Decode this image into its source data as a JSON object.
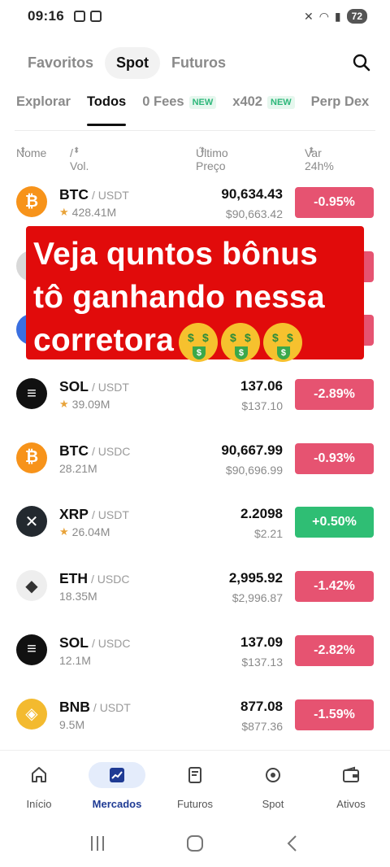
{
  "status_bar": {
    "time": "09:16",
    "battery": "72"
  },
  "market_tabs": [
    {
      "label": "Favoritos",
      "active": false
    },
    {
      "label": "Spot",
      "active": true
    },
    {
      "label": "Futuros",
      "active": false
    }
  ],
  "category_tabs": [
    {
      "label": "Explorar",
      "active": false,
      "badge": ""
    },
    {
      "label": "Todos",
      "active": true,
      "badge": ""
    },
    {
      "label": "0 Fees",
      "active": false,
      "badge": "NEW"
    },
    {
      "label": "x402",
      "active": false,
      "badge": "NEW"
    },
    {
      "label": "Perp Dex",
      "active": false,
      "badge": ""
    }
  ],
  "columns": {
    "name": "Nome",
    "vol": "/ Vol.",
    "price": "Último Preço",
    "change": "Var 24h%"
  },
  "rows": [
    {
      "base": "BTC",
      "quote": "USDT",
      "volume": "428.41M",
      "starred": true,
      "price": "90,634.43",
      "price_usd": "$90,663.42",
      "change": "-0.95%",
      "direction": "neg",
      "icon": "bitcoin-icon",
      "icon_color": "#f7931a"
    },
    {
      "base": "",
      "quote": "",
      "volume": "",
      "starred": false,
      "price": "",
      "price_usd": "",
      "change": "",
      "direction": "neg",
      "icon": "coin-icon",
      "icon_color": "#d8d8d8"
    },
    {
      "base": "",
      "quote": "",
      "volume": "",
      "starred": false,
      "price": "",
      "price_usd": "",
      "change": "",
      "direction": "neg",
      "icon": "coin-icon",
      "icon_color": "#3a6fe0"
    },
    {
      "base": "SOL",
      "quote": "USDT",
      "volume": "39.09M",
      "starred": true,
      "price": "137.06",
      "price_usd": "$137.10",
      "change": "-2.89%",
      "direction": "neg",
      "icon": "solana-icon",
      "icon_color": "#111111"
    },
    {
      "base": "BTC",
      "quote": "USDC",
      "volume": "28.21M",
      "starred": false,
      "price": "90,667.99",
      "price_usd": "$90,696.99",
      "change": "-0.93%",
      "direction": "neg",
      "icon": "bitcoin-icon",
      "icon_color": "#f7931a"
    },
    {
      "base": "XRP",
      "quote": "USDT",
      "volume": "26.04M",
      "starred": true,
      "price": "2.2098",
      "price_usd": "$2.21",
      "change": "+0.50%",
      "direction": "pos",
      "icon": "xrp-icon",
      "icon_color": "#23292f"
    },
    {
      "base": "ETH",
      "quote": "USDC",
      "volume": "18.35M",
      "starred": false,
      "price": "2,995.92",
      "price_usd": "$2,996.87",
      "change": "-1.42%",
      "direction": "neg",
      "icon": "ethereum-icon",
      "icon_color": "#eeeeee"
    },
    {
      "base": "SOL",
      "quote": "USDC",
      "volume": "12.1M",
      "starred": false,
      "price": "137.09",
      "price_usd": "$137.13",
      "change": "-2.82%",
      "direction": "neg",
      "icon": "solana-icon",
      "icon_color": "#111111"
    },
    {
      "base": "BNB",
      "quote": "USDT",
      "volume": "9.5M",
      "starred": false,
      "price": "877.08",
      "price_usd": "$877.36",
      "change": "-1.59%",
      "direction": "neg",
      "icon": "bnb-icon",
      "icon_color": "#f3ba2f"
    }
  ],
  "overlay": {
    "line1": "Veja quntos bônus",
    "line2": "tô ganhando nessa",
    "line3": "corretora",
    "emoji": "money-mouth-face-emoji"
  },
  "bottom_nav": [
    {
      "label": "Início",
      "icon": "home-icon",
      "active": false
    },
    {
      "label": "Mercados",
      "icon": "chart-icon",
      "active": true
    },
    {
      "label": "Futuros",
      "icon": "futures-icon",
      "active": false
    },
    {
      "label": "Spot",
      "icon": "spot-icon",
      "active": false
    },
    {
      "label": "Ativos",
      "icon": "wallet-icon",
      "active": false
    }
  ],
  "colors": {
    "negative": "#e65371",
    "positive": "#2fbe74",
    "accent": "#1f3b94",
    "overlay": "#e10b0b"
  }
}
